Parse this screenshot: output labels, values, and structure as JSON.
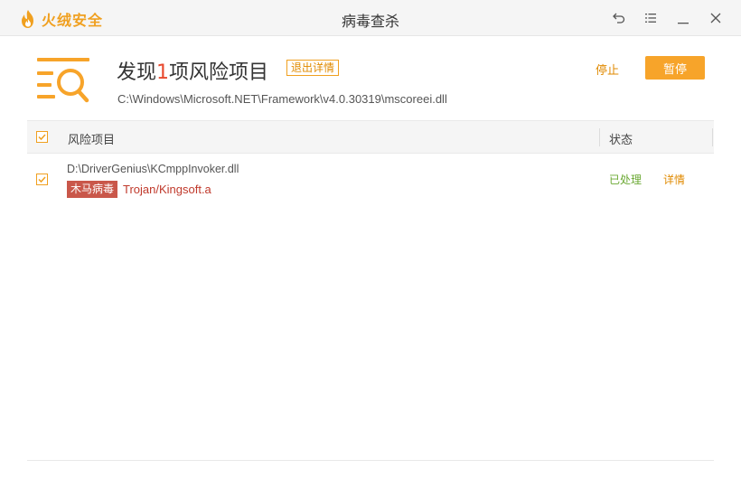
{
  "app": {
    "logo_text": "火绒安全",
    "window_title": "病毒查杀",
    "icons": {
      "logo": "huorong-flame-logo",
      "back": "undo-icon",
      "menu": "menu-icon",
      "minimize": "minimize-icon",
      "close": "close-icon"
    }
  },
  "header": {
    "title_prefix": "发现",
    "title_count": "1",
    "title_suffix": "项风险项目",
    "detail_link": "退出详情",
    "scan_path": "C:\\Windows\\Microsoft.NET\\Framework\\v4.0.30319\\mscoreei.dll",
    "stop_label": "停止",
    "pause_label": "暂停"
  },
  "table": {
    "columns": [
      "风险项目",
      "状态"
    ],
    "header_checked": true,
    "rows": [
      {
        "checked": true,
        "path": "D:\\DriverGenius\\KCmppInvoker.dll",
        "threat_type": "木马病毒",
        "threat_name": "Trojan/Kingsoft.a",
        "status": "已处理",
        "detail": "详情"
      }
    ]
  },
  "colors": {
    "accent": "#f7a42a",
    "count_red": "#e8492e",
    "threat_badge": "#c9574a",
    "threat_text": "#c0392b",
    "status_green": "#6aa832",
    "link_orange": "#e08a00"
  }
}
